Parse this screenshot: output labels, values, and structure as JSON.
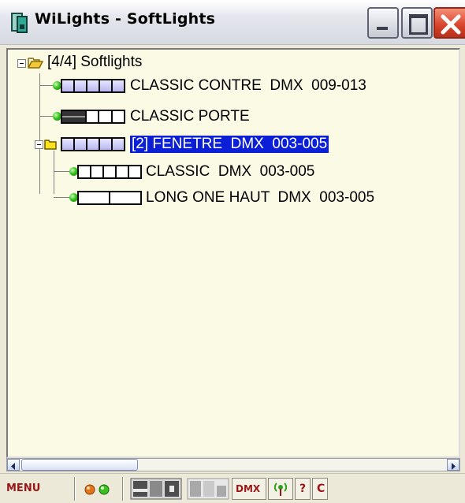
{
  "window": {
    "title": "WiLights - SoftLights",
    "icons": [
      "app-icon",
      "minimize-icon",
      "maximize-icon",
      "close-icon"
    ]
  },
  "tree": {
    "root": {
      "label": "[4/4] Softlights",
      "icon": "open-folder-icon",
      "expanded": true
    },
    "items": [
      {
        "label": "CLASSIC CONTRE  DMX  009-013",
        "status": "green",
        "channels": 5
      },
      {
        "label": "CLASSIC PORTE",
        "status": "green",
        "channels": 5
      },
      {
        "label": "[2] FENETRE  DMX  003-005",
        "icon": "folder-icon",
        "channels": 5,
        "selected": true,
        "expanded": true,
        "children": [
          {
            "label": "CLASSIC  DMX  003-005",
            "status": "green",
            "channels": 5
          },
          {
            "label": "LONG ONE HAUT  DMX  003-005",
            "status": "green",
            "channels": 2
          }
        ]
      }
    ]
  },
  "statusbar": {
    "menu_label": "MENU",
    "dmx_label": "DMX",
    "help_label": "?",
    "c_label": "C",
    "icons": [
      "status-leds-icon",
      "layout-icon-1",
      "layout-icon-2",
      "antenna-icon"
    ]
  },
  "colors": {
    "selection": "#0a1fd6",
    "tree_bg": "#fbfbe5",
    "status_green": "#38c21f",
    "menu_red": "#9a1616"
  }
}
